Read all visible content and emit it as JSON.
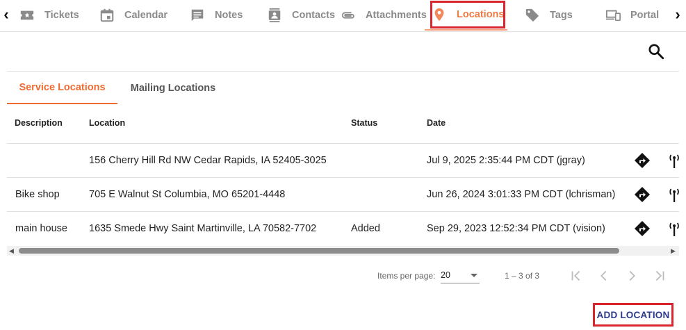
{
  "top_tabs": [
    {
      "label": "Tickets",
      "icon": "ticket-icon"
    },
    {
      "label": "Calendar",
      "icon": "calendar-icon"
    },
    {
      "label": "Notes",
      "icon": "notes-icon"
    },
    {
      "label": "Contacts",
      "icon": "contacts-icon"
    },
    {
      "label": "Attachments",
      "icon": "paperclip-icon"
    },
    {
      "label": "Locations",
      "icon": "location-pin-icon",
      "active": true
    },
    {
      "label": "Tags",
      "icon": "tag-icon"
    },
    {
      "label": "Portal",
      "icon": "devices-icon"
    }
  ],
  "sub_tabs": [
    {
      "label": "Service Locations",
      "active": true
    },
    {
      "label": "Mailing Locations"
    }
  ],
  "table": {
    "headers": {
      "description": "Description",
      "location": "Location",
      "status": "Status",
      "date": "Date"
    },
    "rows": [
      {
        "description": "",
        "location": "156 Cherry Hill Rd NW Cedar Rapids, IA 52405-3025",
        "status": "",
        "date": "Jul 9, 2025 2:35:44 PM CDT (jgray)"
      },
      {
        "description": "Bike shop",
        "location": "705 E Walnut St Columbia, MO 65201-4448",
        "status": "",
        "date": "Jun 26, 2024 3:01:33 PM CDT (lchrisman)"
      },
      {
        "description": "main house",
        "location": "1635 Smede Hwy Saint Martinville, LA 70582-7702",
        "status": "Added",
        "date": "Sep 29, 2023 12:52:34 PM CDT (vision)"
      }
    ]
  },
  "paginator": {
    "items_per_page_label": "Items per page:",
    "items_per_page_value": "20",
    "range_label": "1 – 3 of 3"
  },
  "actions": {
    "add_location": "ADD LOCATION"
  },
  "colors": {
    "accent": "#ef6b34",
    "highlight_box": "#d9262e",
    "add_button_text": "#2b3a8c"
  }
}
